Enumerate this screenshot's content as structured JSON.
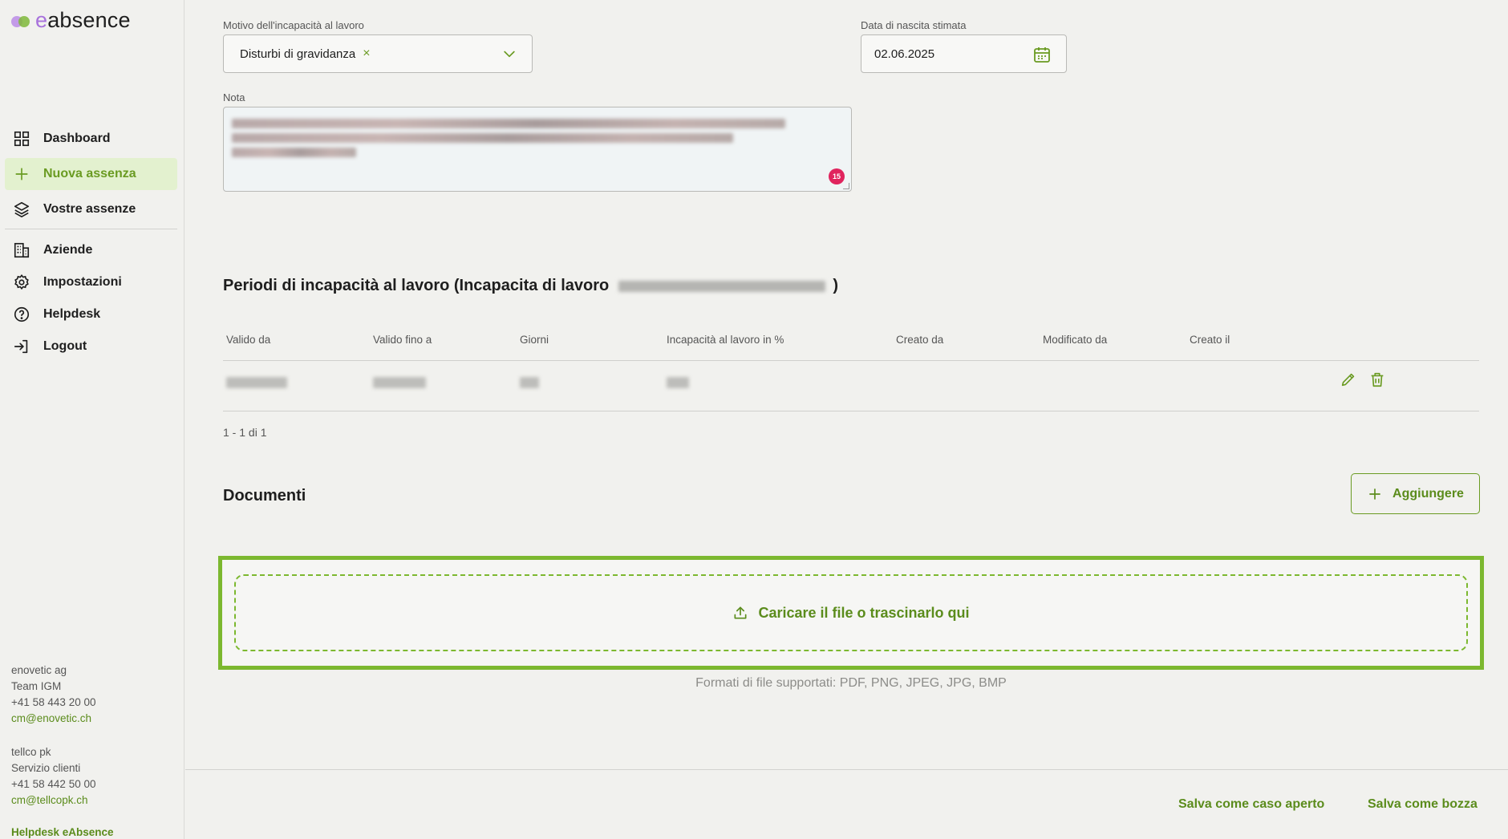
{
  "app": {
    "logo_prefix": "e",
    "logo_suffix": "absence",
    "logo_icon": "logo-circles"
  },
  "sidebar": {
    "items": [
      {
        "label": "Dashboard",
        "icon": "grid-icon"
      },
      {
        "label": "Nuova assenza",
        "icon": "plus-icon",
        "active": true
      },
      {
        "label": "Vostre assenze",
        "icon": "layers-icon"
      },
      {
        "label": "Aziende",
        "icon": "building-icon"
      },
      {
        "label": "Impostazioni",
        "icon": "gear-icon"
      },
      {
        "label": "Helpdesk",
        "icon": "question-icon"
      },
      {
        "label": "Logout",
        "icon": "logout-icon"
      }
    ],
    "contact1": {
      "company": "enovetic ag",
      "team": "Team IGM",
      "phone": "+41 58 443 20 00",
      "email": "cm@enovetic.ch"
    },
    "contact2": {
      "company": "tellco pk",
      "team": "Servizio clienti",
      "phone": "+41 58 442 50 00",
      "email": "cm@tellcopk.ch"
    },
    "helpdesk_link": "Helpdesk eAbsence"
  },
  "form": {
    "reason_label": "Motivo dell'incapacità al lavoro",
    "reason_value": "Disturbi di gravidanza",
    "reason_clear": "×",
    "birth_label": "Data di nascita stimata",
    "birth_value": "02.06.2025",
    "note_label": "Nota",
    "note_badge": "15"
  },
  "periods": {
    "title": "Periodi di incapacità al lavoro (Incapacita di lavoro",
    "title_close": ")",
    "columns": [
      "Valido da",
      "Valido fino a",
      "Giorni",
      "Incapacità al lavoro in %",
      "Creato da",
      "Modificato da",
      "Creato il"
    ],
    "pager": "1 - 1 di 1"
  },
  "documents": {
    "title": "Documenti",
    "add_label": "Aggiungere",
    "upload_label": "Caricare il file o trascinarlo qui",
    "formats": "Formati di file supportati: PDF, PNG, JPEG, JPG, BMP"
  },
  "footer": {
    "save_open": "Salva come caso aperto",
    "save_draft": "Salva come bozza"
  },
  "colors": {
    "accent": "#6a9b22",
    "upload_border": "#7cb82f",
    "badge": "#e0245e",
    "active_bg": "#e3f1cf",
    "logo_purple": "#a872dc"
  }
}
